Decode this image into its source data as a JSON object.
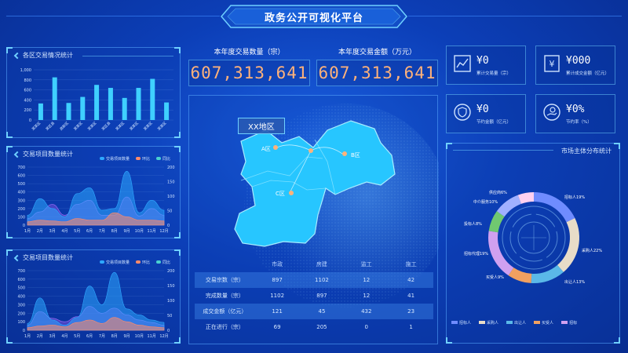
{
  "header": {
    "title": "政务公开可视化平台"
  },
  "kpis": [
    {
      "label": "本年度交易数量（宗）",
      "value": "607,313,641"
    },
    {
      "label": "本年度交易金额（万元）",
      "value": "607,313,641"
    }
  ],
  "stat_cards": [
    {
      "value": "¥0",
      "label": "累计交易量（宗）",
      "icon": "chart-icon"
    },
    {
      "value": "¥000",
      "label": "累计成交金额（亿元）",
      "icon": "yen-icon"
    },
    {
      "value": "¥0",
      "label": "节约金额（亿元）",
      "icon": "shield-icon"
    },
    {
      "value": "¥0%",
      "label": "节约率（%）",
      "icon": "hand-coin-icon"
    }
  ],
  "panel_district": {
    "title": "各区交易情况统计",
    "chart_data": {
      "type": "bar",
      "categories": [
        "某某区",
        "某区县",
        "高新区",
        "某某区",
        "某某区",
        "某区县",
        "某某区",
        "某某区",
        "某某区",
        "某某区"
      ],
      "values": [
        330,
        850,
        340,
        460,
        700,
        640,
        440,
        640,
        820,
        350
      ],
      "ylim": [
        0,
        1000
      ],
      "yticks": [
        "1,000",
        "800",
        "600",
        "400",
        "200",
        "0"
      ]
    }
  },
  "panel_items_1": {
    "title": "交易项目数量统计",
    "legend": [
      "交易项目数量",
      "环比",
      "同比"
    ],
    "chart_data": {
      "type": "area",
      "categories": [
        "1月",
        "2月",
        "3月",
        "4月",
        "5月",
        "6月",
        "7月",
        "8月",
        "9月",
        "10月",
        "11月",
        "12月"
      ],
      "series": [
        {
          "name": "交易项目数量",
          "values": [
            120,
            320,
            200,
            100,
            380,
            450,
            180,
            200,
            650,
            150,
            300,
            180
          ]
        },
        {
          "name": "环比",
          "values": [
            40,
            60,
            50,
            40,
            80,
            60,
            60,
            150,
            100,
            60,
            60,
            50
          ]
        },
        {
          "name": "同比",
          "values": [
            80,
            160,
            250,
            120,
            250,
            300,
            120,
            120,
            340,
            110,
            200,
            120
          ]
        }
      ],
      "ylim_left": [
        0,
        700
      ],
      "yticks_left": [
        "700",
        "600",
        "500",
        "400",
        "300",
        "200",
        "100",
        "0"
      ],
      "ylim_right": [
        0,
        200
      ],
      "yticks_right": [
        "200",
        "150",
        "100",
        "50",
        "0"
      ]
    }
  },
  "panel_items_2": {
    "title": "交易项目数量统计",
    "legend": [
      "交易项目数量",
      "环比",
      "同比"
    ],
    "chart_data": {
      "type": "area",
      "categories": [
        "1月",
        "2月",
        "3月",
        "4月",
        "5月",
        "6月",
        "7月",
        "8月",
        "9月",
        "10月",
        "11月",
        "12月"
      ],
      "series": [
        {
          "name": "交易项目数量",
          "values": [
            80,
            380,
            120,
            60,
            150,
            520,
            300,
            680,
            250,
            180,
            120,
            90
          ]
        },
        {
          "name": "环比",
          "values": [
            30,
            50,
            60,
            40,
            90,
            120,
            80,
            150,
            100,
            60,
            40,
            30
          ]
        },
        {
          "name": "同比",
          "values": [
            60,
            220,
            140,
            100,
            160,
            280,
            200,
            260,
            180,
            120,
            90,
            60
          ]
        }
      ],
      "ylim_left": [
        0,
        700
      ],
      "yticks_left": [
        "700",
        "600",
        "500",
        "400",
        "300",
        "200",
        "100",
        "0"
      ],
      "ylim_right": [
        0,
        200
      ],
      "yticks_right": [
        "200",
        "150",
        "100",
        "50",
        "0"
      ]
    }
  },
  "map": {
    "region_title": "XX地区",
    "regions": [
      "A区",
      "B区",
      "C区"
    ]
  },
  "table": {
    "headers": [
      "",
      "市政",
      "房建",
      "监工",
      "施工"
    ],
    "rows": [
      [
        "交易宗数（宗）",
        "897",
        "1102",
        "12",
        "42"
      ],
      [
        "完成数量（宗）",
        "1102",
        "897",
        "12",
        "41"
      ],
      [
        "成交金额（亿元）",
        "121",
        "45",
        "432",
        "23"
      ],
      [
        "正在进行（宗）",
        "69",
        "205",
        "0",
        "1"
      ]
    ]
  },
  "panel_market": {
    "title": "市场主体分布统计",
    "chart_data": {
      "type": "pie",
      "slices": [
        {
          "name": "招标人",
          "value": 19,
          "label": "招标人19%",
          "color": "#6f8cff"
        },
        {
          "name": "采购人",
          "value": 22,
          "label": "采购人22%",
          "color": "#e8dcc8"
        },
        {
          "name": "出让人",
          "value": 13,
          "label": "出让人13%",
          "color": "#5ab8e8"
        },
        {
          "name": "买受人",
          "value": 9,
          "label": "买受人9%",
          "color": "#f0a060"
        },
        {
          "name": "招标代理",
          "value": 19,
          "label": "招标代理19%",
          "color": "#d0a0f0"
        },
        {
          "name": "投标人",
          "value": 8,
          "label": "投标人8%",
          "color": "#70c870"
        },
        {
          "name": "中介服务",
          "value": 10,
          "label": "中介服务10%",
          "color": "#a0b0ff"
        },
        {
          "name": "供应商",
          "value": 6,
          "label": "供应商6%",
          "color": "#ffd0f0"
        }
      ],
      "legend": [
        "招标人",
        "采购人",
        "出让人",
        "买受人",
        "招标"
      ]
    }
  }
}
